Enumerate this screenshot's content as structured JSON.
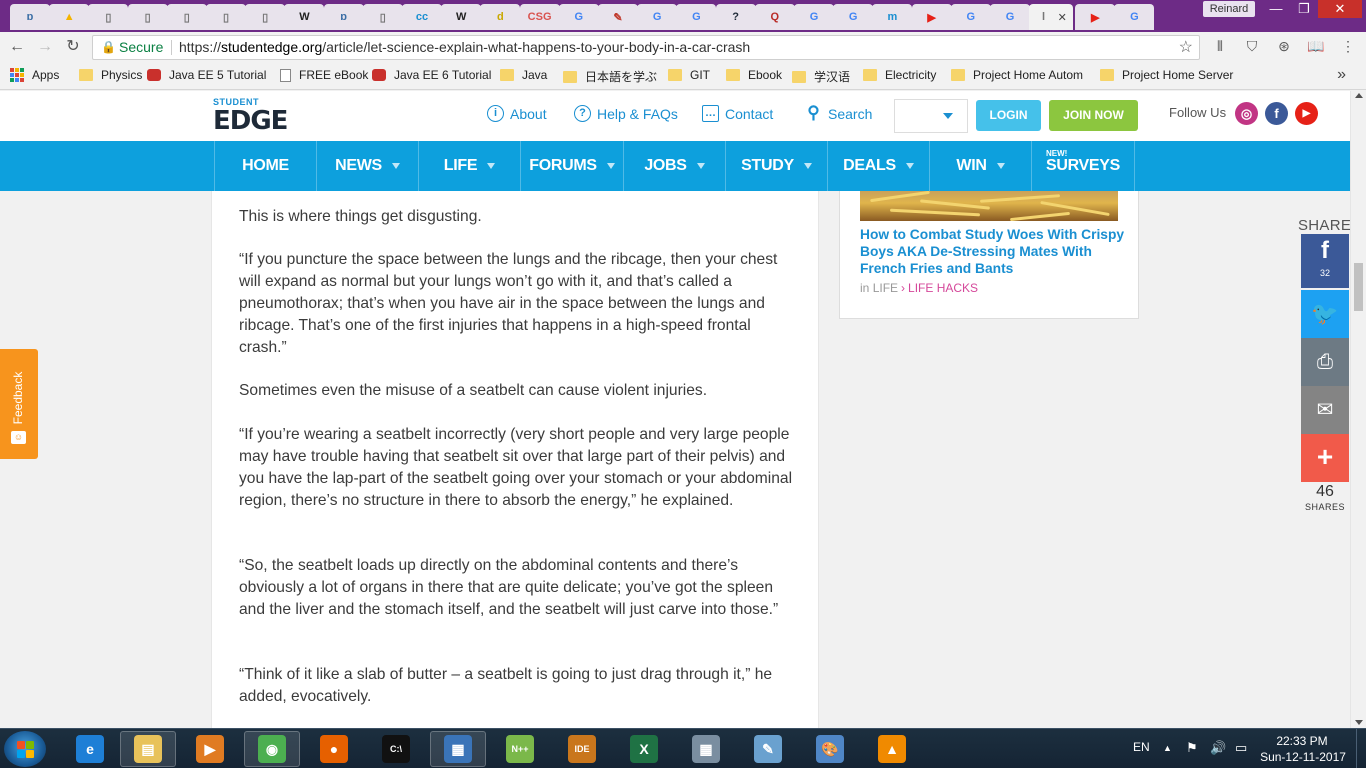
{
  "browser": {
    "tabs": [
      {
        "icon": "ɒ",
        "color": "#3b6ea5"
      },
      {
        "icon": "▲",
        "color": "#f4b400"
      },
      {
        "icon": "▯",
        "color": "#777"
      },
      {
        "icon": "▯",
        "color": "#777"
      },
      {
        "icon": "▯",
        "color": "#777"
      },
      {
        "icon": "▯",
        "color": "#777"
      },
      {
        "icon": "▯",
        "color": "#777"
      },
      {
        "icon": "W",
        "color": "#222"
      },
      {
        "icon": "ɒ",
        "color": "#3b6ea5"
      },
      {
        "icon": "▯",
        "color": "#777"
      },
      {
        "icon": "cc",
        "color": "#1a8fd1"
      },
      {
        "icon": "W",
        "color": "#222"
      },
      {
        "icon": "d",
        "color": "#c9a800"
      },
      {
        "icon": "CSG",
        "color": "#d9534f"
      },
      {
        "icon": "G",
        "color": "#4285f4"
      },
      {
        "icon": "✎",
        "color": "#c0392b"
      },
      {
        "icon": "G",
        "color": "#4285f4"
      },
      {
        "icon": "G",
        "color": "#4285f4"
      },
      {
        "icon": "?",
        "color": "#1e2a38"
      },
      {
        "icon": "Q",
        "color": "#b92b27"
      },
      {
        "icon": "G",
        "color": "#4285f4"
      },
      {
        "icon": "G",
        "color": "#4285f4"
      },
      {
        "icon": "m",
        "color": "#1a8fd1"
      },
      {
        "icon": "▶",
        "color": "#e62117"
      },
      {
        "icon": "G",
        "color": "#4285f4"
      },
      {
        "icon": "G",
        "color": "#4285f4"
      }
    ],
    "active_tab": {
      "icon": "l",
      "close": "✕"
    },
    "tabs_after": [
      {
        "icon": "▶",
        "color": "#e62117"
      },
      {
        "icon": "G",
        "color": "#4285f4"
      }
    ],
    "profile_name": "Reinard",
    "window": {
      "minimize": "—",
      "maximize": "❐",
      "close": "✕"
    },
    "nav": {
      "back": "←",
      "forward": "→",
      "reload": "↻"
    },
    "secure_label": "Secure",
    "url_prefix": "https://",
    "url_host": "studentedge.org",
    "url_path": "/article/let-science-explain-what-happens-to-your-body-in-a-car-crash",
    "star": "☆",
    "extensions": [
      "⦀",
      "⛉",
      "⊛",
      "📖",
      "⋮"
    ],
    "bookmarks": [
      {
        "label": "Apps",
        "kind": "apps"
      },
      {
        "label": "Physics",
        "kind": "folder"
      },
      {
        "label": "Java EE 5 Tutorial",
        "kind": "red"
      },
      {
        "label": "FREE eBook",
        "kind": "page"
      },
      {
        "label": "Java EE 6 Tutorial",
        "kind": "red"
      },
      {
        "label": "Java",
        "kind": "folder"
      },
      {
        "label": "日本語を学ぶ",
        "kind": "folder"
      },
      {
        "label": "GIT",
        "kind": "folder"
      },
      {
        "label": "Ebook",
        "kind": "folder"
      },
      {
        "label": "学汉语",
        "kind": "folder"
      },
      {
        "label": "Electricity",
        "kind": "folder"
      },
      {
        "label": "Project Home Autom",
        "kind": "folder"
      },
      {
        "label": "Project Home Server",
        "kind": "folder"
      }
    ],
    "bookmarks_more": "»"
  },
  "site": {
    "logo_top": "STUDENT",
    "logo_main": "EDGE",
    "header_links": [
      {
        "label": "About",
        "icon": "i"
      },
      {
        "label": "Help & FAQs",
        "icon": "?"
      },
      {
        "label": "Contact",
        "icon": "…"
      },
      {
        "label": "Search",
        "icon": "⚲"
      }
    ],
    "login": "LOGIN",
    "join": "JOIN NOW",
    "follow": "Follow Us",
    "social": [
      {
        "name": "instagram",
        "glyph": "◎",
        "color": "#c13584"
      },
      {
        "name": "facebook",
        "glyph": "f",
        "color": "#3b5998"
      },
      {
        "name": "youtube",
        "glyph": "▶",
        "color": "#e62117"
      }
    ],
    "nav": [
      {
        "label": "HOME",
        "dropdown": false
      },
      {
        "label": "NEWS",
        "dropdown": true
      },
      {
        "label": "LIFE",
        "dropdown": true
      },
      {
        "label": "FORUMS",
        "dropdown": true
      },
      {
        "label": "JOBS",
        "dropdown": true
      },
      {
        "label": "STUDY",
        "dropdown": true
      },
      {
        "label": "DEALS",
        "dropdown": true
      },
      {
        "label": "WIN",
        "dropdown": true
      },
      {
        "label": "SURVEYS",
        "dropdown": false
      }
    ],
    "nav_new_badge": "NEW!"
  },
  "article": {
    "paragraphs": [
      "This is where things get disgusting.",
      "“If you puncture the space between the lungs and the ribcage, then your chest will expand as normal but your lungs won’t go with it, and that’s called a pneumothorax; that’s when you have air in the space between the lungs and ribcage. That’s one of the first injuries that happens in a high-speed frontal crash.”",
      "Sometimes even the misuse of a seatbelt can cause violent injuries.",
      "“If you’re wearing a seatbelt incorrectly (very short people and very large people may have trouble having that seatbelt sit over that large part of their pelvis) and you have the lap-part of the seatbelt going over your stomach or your abdominal region, there’s no structure in there to absorb the energy,” he explained.",
      "“So, the seatbelt loads up directly on the abdominal contents and there’s obviously a lot of organs in there that are quite delicate; you’ve got the spleen and the liver and the stomach itself, and the seatbelt will just carve into those.”",
      "“Think of it like a slab of butter – a seatbelt is going to just drag through it,” he added, evocatively."
    ]
  },
  "sidebar": {
    "title": "How to Combat Study Woes With Crispy Boys AKA De-Stressing Mates With French Fries and Bants",
    "in_label": "in",
    "category": "LIFE",
    "separator": "›",
    "subcategory": "LIFE HACKS"
  },
  "feedback": {
    "label": "Feedback"
  },
  "share": {
    "heading": "SHARE",
    "facebook_glyph": "f",
    "facebook_count": "32",
    "twitter_glyph": "🐦",
    "print_glyph": "⎙",
    "mail_glyph": "✉",
    "more_glyph": "+",
    "total": "46",
    "total_label": "SHARES"
  },
  "taskbar": {
    "apps": [
      {
        "name": "internet-explorer",
        "glyph": "e",
        "bg": "#1e7fd6",
        "open": false
      },
      {
        "name": "file-explorer",
        "glyph": "▤",
        "bg": "#e8c25a",
        "open": true
      },
      {
        "name": "media-player",
        "glyph": "▶",
        "bg": "#e07b22",
        "open": false
      },
      {
        "name": "chrome",
        "glyph": "◉",
        "bg": "#4caf50",
        "open": true
      },
      {
        "name": "firefox",
        "glyph": "●",
        "bg": "#e66000",
        "open": false
      },
      {
        "name": "command-prompt",
        "glyph": "C:\\",
        "bg": "#111",
        "open": false
      },
      {
        "name": "network",
        "glyph": "▦",
        "bg": "#3a74b8",
        "open": true
      },
      {
        "name": "notepad-plus",
        "glyph": "N++",
        "bg": "#7bb84a",
        "open": false
      },
      {
        "name": "java-ee-ide",
        "glyph": "IDE",
        "bg": "#c9761c",
        "open": false
      },
      {
        "name": "excel",
        "glyph": "X",
        "bg": "#1f7244",
        "open": false
      },
      {
        "name": "calculator",
        "glyph": "▦",
        "bg": "#7a8ea0",
        "open": false
      },
      {
        "name": "notes",
        "glyph": "✎",
        "bg": "#6aa1cf",
        "open": false
      },
      {
        "name": "paint",
        "glyph": "🎨",
        "bg": "#4f86c6",
        "open": false
      },
      {
        "name": "vlc",
        "glyph": "▲",
        "bg": "#f08a00",
        "open": false
      }
    ],
    "language": "EN",
    "tray": [
      "▲",
      "⚑",
      "🔊",
      "▭"
    ],
    "time": "22:33 PM",
    "date": "Sun-12-11-2017"
  }
}
